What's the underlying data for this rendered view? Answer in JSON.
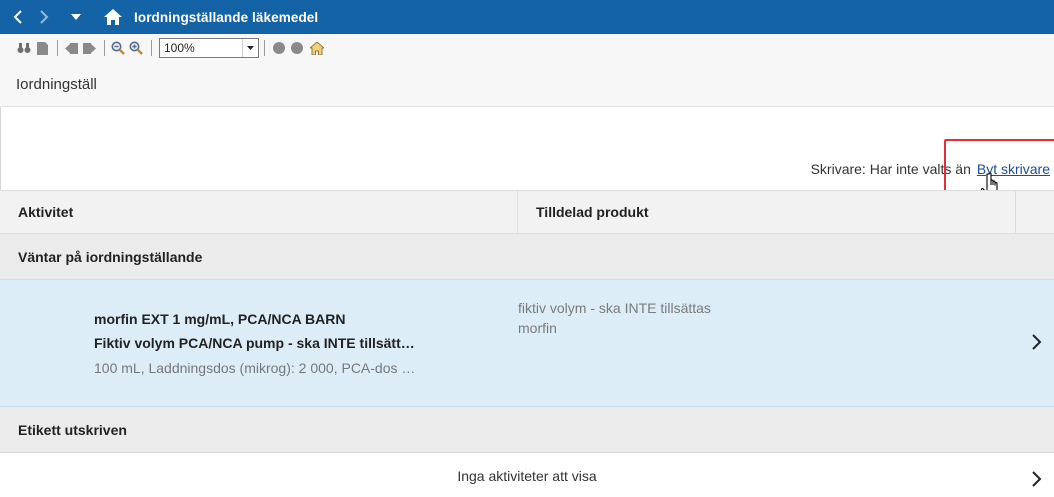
{
  "titlebar": {
    "title": "Iordningställande läkemedel",
    "background": "#1463a6"
  },
  "toolbar": {
    "zoom_value": "100%",
    "icons": [
      "binoculars-icon",
      "page-icon",
      "prev-page-icon",
      "next-page-icon",
      "zoom-out-icon",
      "zoom-in-icon",
      "record-icon",
      "stop-icon",
      "home-icon"
    ]
  },
  "section": {
    "title": "Iordningställ"
  },
  "printer": {
    "label": "Skrivare: Har inte valts än",
    "link": "Byt skrivare"
  },
  "table": {
    "columns": [
      "Aktivitet",
      "Tilldelad produkt"
    ]
  },
  "groups": [
    {
      "title": "Väntar på iordningställande",
      "items": [
        {
          "line1": "morfin EXT 1 mg/mL, PCA/NCA BARN",
          "line2": "Fiktiv volym PCA/NCA pump - ska INTE tillsätt…",
          "line3": "100 mL, Laddningsdos (mikrog): 2 000, PCA-dos …",
          "product1": "fiktiv volym - ska INTE tillsättas",
          "product2": "morfin"
        }
      ]
    },
    {
      "title": "Etikett utskriven",
      "empty_text": "Inga aktiviteter att visa"
    }
  ],
  "colors": {
    "accent": "#1463a6",
    "selected_row": "#dcedf8",
    "highlight": "#e0303a",
    "link": "#1a4f9c"
  }
}
